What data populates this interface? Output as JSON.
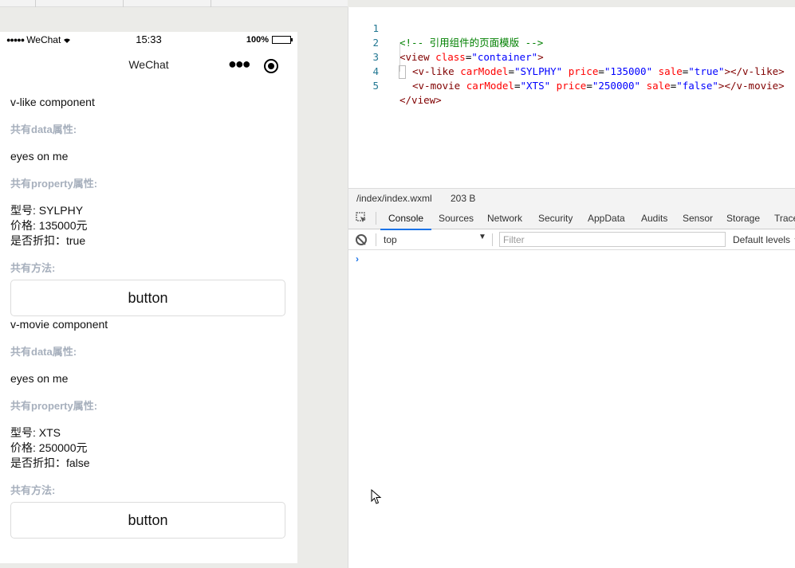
{
  "simulator": {
    "status": {
      "signal": "●●●●●",
      "carrier": "WeChat",
      "time": "15:33",
      "battery": "100%",
      "battery_level": 1.0
    },
    "nav_title": "WeChat",
    "components": [
      {
        "name": "v-like component",
        "data_label": "共有data属性:",
        "data_value": "eyes on me",
        "property_label": "共有property属性:",
        "model": "型号: SYLPHY",
        "price": "价格: 135000元",
        "sale": "是否折扣：true",
        "method_label": "共有方法:",
        "button": "button"
      },
      {
        "name": "v-movie component",
        "data_label": "共有data属性:",
        "data_value": "eyes on me",
        "property_label": "共有property属性:",
        "model": "型号: XTS",
        "price": "价格: 250000元",
        "sale": "是否折扣：false",
        "method_label": "共有方法:",
        "button": "button"
      }
    ]
  },
  "editor": {
    "lines": [
      {
        "num": "1",
        "comment": "<!-- 引用组件的页面模版 -->"
      },
      {
        "num": "2",
        "open": "<view",
        "attr": "class",
        "eq": "=",
        "val": "\"container\"",
        "close": ">"
      },
      {
        "num": "3",
        "open": "<v-like",
        "a1": "carModel",
        "v1": "\"SYLPHY\"",
        "a2": "price",
        "v2": "\"135000\"",
        "a3": "sale",
        "v3": "\"true\"",
        "close": "></v-like>"
      },
      {
        "num": "4",
        "open": "<v-movie",
        "a1": "carModel",
        "v1": "\"XTS\"",
        "a2": "price",
        "v2": "\"250000\"",
        "a3": "sale",
        "v3": "\"false\"",
        "close": "></v-movie>"
      },
      {
        "num": "5",
        "close": "</view>"
      }
    ]
  },
  "filebar": {
    "path": "/index/index.wxml",
    "size": "203 B"
  },
  "devtools": {
    "tabs": [
      "Console",
      "Sources",
      "Network",
      "Security",
      "AppData",
      "Audits",
      "Sensor",
      "Storage",
      "Trace"
    ],
    "active_tab": "Console",
    "context": "top",
    "filter_placeholder": "Filter",
    "levels": "Default levels",
    "prompt": "›"
  }
}
